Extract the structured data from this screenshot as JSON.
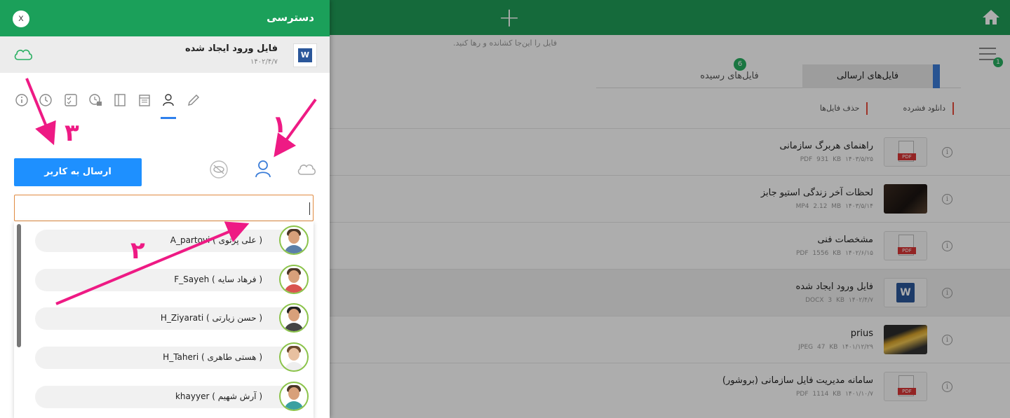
{
  "app": {
    "drop_hint": "فایل را این‌جا کشانده و رها کنید.",
    "menu_badge": "1"
  },
  "tabs": {
    "sent": "فایل‌های ارسالی",
    "received": "فایل‌های رسیده",
    "received_badge": "6"
  },
  "actions": {
    "download_zip": "دانلود فشرده",
    "delete_files": "حذف فایل‌ها"
  },
  "files": [
    {
      "name": "راهنمای هربرگ سازمانی",
      "meta": "PDF  931 KB  ۱۴۰۳/۵/۲۵",
      "thumb": "pdf"
    },
    {
      "name": "لحظات آخر زندگی استیو جابز",
      "meta": "MP4  2.12 MB  ۱۴۰۳/۵/۱۴",
      "thumb": "video"
    },
    {
      "name": "مشخصات فنی",
      "meta": "PDF  1556 KB  ۱۴۰۲/۶/۱۵",
      "thumb": "pdf"
    },
    {
      "name": "فایل ورود ایجاد شده",
      "meta": "DOCX  3 KB  ۱۴۰۲/۴/۷",
      "thumb": "word"
    },
    {
      "name": "prius",
      "meta": "JPEG  47 KB  ۱۴۰۱/۱۲/۲۹",
      "thumb": "image"
    },
    {
      "name": "سامانه مدیریت فایل سازمانی (بروشور)",
      "meta": "PDF  1114 KB  ۱۴۰۱/۱۰/۷",
      "thumb": "pdf"
    }
  ],
  "pdf_tag": "PDF",
  "word_letter": "W",
  "panel": {
    "title": "دسترسی",
    "close": "x",
    "file_name": "فایل ورود ایجاد شده",
    "file_date": "۱۴۰۲/۴/۷",
    "send_button": "ارسال به کاربر",
    "search_value": ""
  },
  "users": [
    {
      "label": "A_partovi  ( علی پرتوی )"
    },
    {
      "label": "F_Sayeh  ( فرهاد سایه )"
    },
    {
      "label": "H_Ziyarati  ( حسن زیارتی )"
    },
    {
      "label": "H_Taheri  ( هستی طاهری )"
    },
    {
      "label": "khayyer  ( آرش شهیم )"
    }
  ],
  "annotations": {
    "num1": "۱",
    "num2": "۲",
    "num3": "۳"
  },
  "colors": {
    "header_green": "#1f9d57",
    "send_blue": "#1e90ff",
    "annotation_magenta": "#ee1a84",
    "tab_accent": "#3b7dd8"
  },
  "icons": [
    "home-icon",
    "plus-icon",
    "menu-icon",
    "cloud-icon",
    "info-icon",
    "history-icon",
    "checklist-icon",
    "clock-lock-icon",
    "copy-icon",
    "calendar-icon",
    "user-icon",
    "pencil-icon",
    "eye-off-icon"
  ]
}
